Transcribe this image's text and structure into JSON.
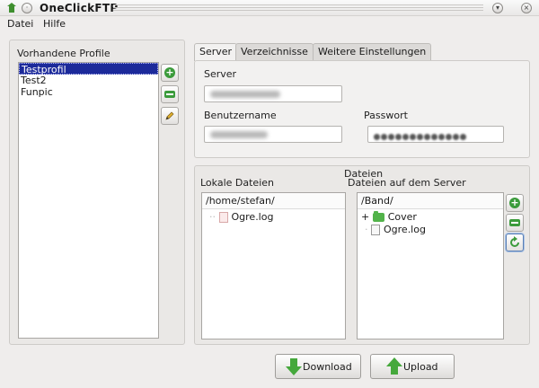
{
  "window": {
    "title": "OneClickFTP",
    "min_glyph": "▾",
    "close_glyph": "×",
    "pin_glyph": "·"
  },
  "menu": {
    "items": [
      "Datei",
      "Hilfe"
    ]
  },
  "profiles": {
    "label": "Vorhandene Profile",
    "items": [
      "Testprofil",
      "Test2",
      "Funpic"
    ],
    "selected_index": 0,
    "buttons": {
      "add_icon": "plus-icon",
      "remove_icon": "minus-icon",
      "edit_icon": "pencil-icon"
    }
  },
  "tabs": [
    "Server",
    "Verzeichnisse",
    "Weitere Einstellungen"
  ],
  "server_tab": {
    "server_label": "Server",
    "user_label": "Benutzername",
    "password_label": "Passwort"
  },
  "files": {
    "group_label": "Dateien",
    "local": {
      "label": "Lokale Dateien",
      "path": "/home/stefan/",
      "entries": [
        {
          "name": "Ogre.log",
          "type": "file"
        }
      ]
    },
    "remote": {
      "label": "Dateien auf dem Server",
      "path": "/Band/",
      "entries": [
        {
          "name": "Cover",
          "type": "folder",
          "expander": "+"
        },
        {
          "name": "Ogre.log",
          "type": "file"
        }
      ]
    }
  },
  "actions": {
    "download": "Download",
    "upload": "Upload"
  },
  "colors": {
    "selection": "#1c2a9a",
    "accent_green": "#3b9b3b"
  }
}
